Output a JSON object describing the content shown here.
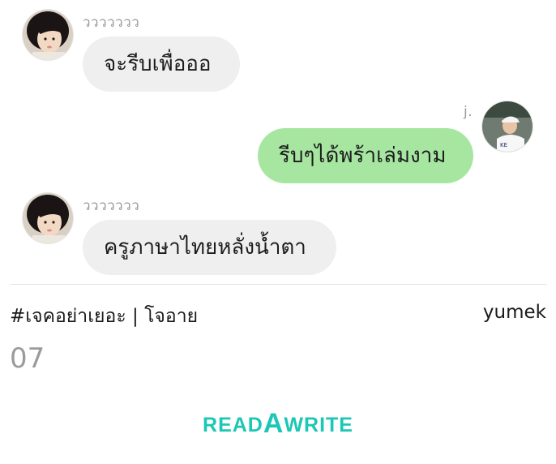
{
  "messages": [
    {
      "sender": "ววววววว",
      "text": "จะรีบเพื่อออ",
      "side": "left"
    },
    {
      "sender": "j.",
      "text": "รีบๆได้พร้าเล่มงาม",
      "side": "right"
    },
    {
      "sender": "ววววววว",
      "text": "ครูภาษาไทยหลั่งน้ำตา",
      "side": "left"
    }
  ],
  "story": {
    "title": "#เจคอย่าเยอะ | โจอาย",
    "author": "yumek",
    "chapter": "07"
  },
  "logo": {
    "part1": "READ",
    "part2": "A",
    "part3": "WRITE"
  },
  "colors": {
    "incoming_bubble": "#efefef",
    "outgoing_bubble": "#a6e6a0",
    "logo": "#1cc7b5",
    "muted_text": "#9a9a9a"
  }
}
